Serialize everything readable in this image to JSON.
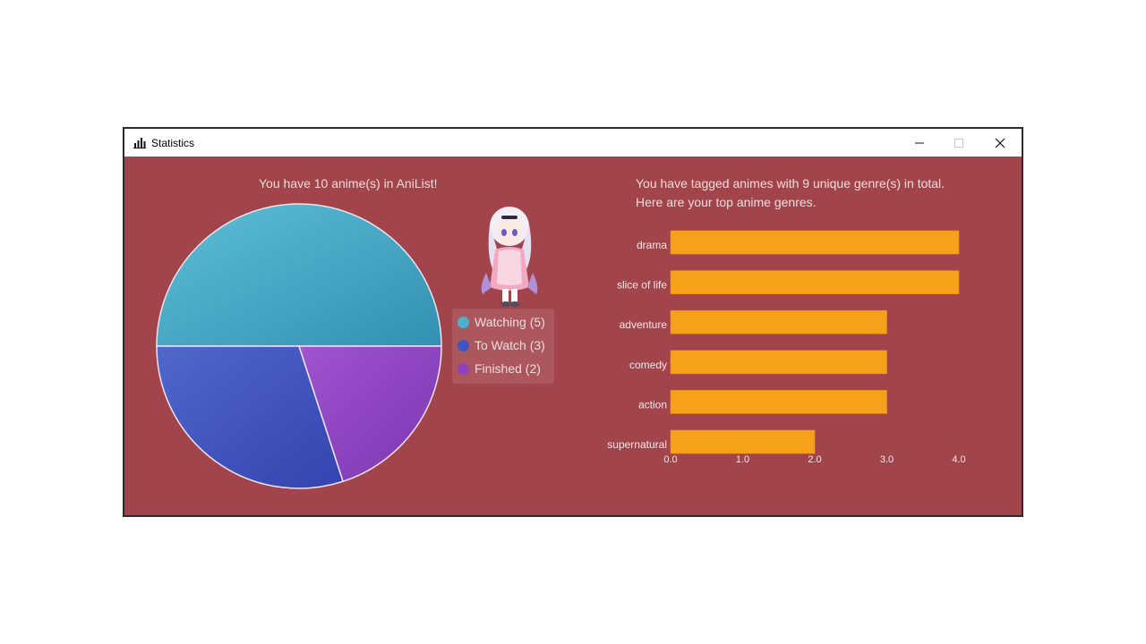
{
  "window": {
    "title": "Statistics",
    "icon": "bar-chart-icon",
    "controls": [
      "minimize-icon",
      "maximize-icon",
      "close-icon"
    ]
  },
  "colors": {
    "background": "#a2444b",
    "watching": "#4ab0cb",
    "to_watch": "#3f55c0",
    "finished": "#8e42bf",
    "bar": "#f7a11a"
  },
  "status_section": {
    "caption": "You have 10 anime(s) in AniList!",
    "legend": [
      {
        "label": "Watching (5)",
        "color": "#4ab0cb"
      },
      {
        "label": "To Watch (3)",
        "color": "#3f55c0"
      },
      {
        "label": "Finished (2)",
        "color": "#8e42bf"
      }
    ],
    "mascot": "anime-girl-mascot-image"
  },
  "genre_section": {
    "caption_line1": "You have tagged animes with 9 unique genre(s) in total.",
    "caption_line2": "Here are your top anime genres."
  },
  "chart_data": [
    {
      "type": "pie",
      "categories": [
        "Watching",
        "To Watch",
        "Finished"
      ],
      "values": [
        5,
        3,
        2
      ],
      "legend": "right"
    },
    {
      "type": "bar",
      "orientation": "horizontal",
      "categories": [
        "drama",
        "slice of life",
        "adventure",
        "comedy",
        "action",
        "supernatural"
      ],
      "values": [
        4,
        4,
        3,
        3,
        3,
        2
      ],
      "xlim": [
        0,
        4
      ],
      "ticks": [
        "0.0",
        "1.0",
        "2.0",
        "3.0",
        "4.0"
      ],
      "grid": false
    }
  ]
}
